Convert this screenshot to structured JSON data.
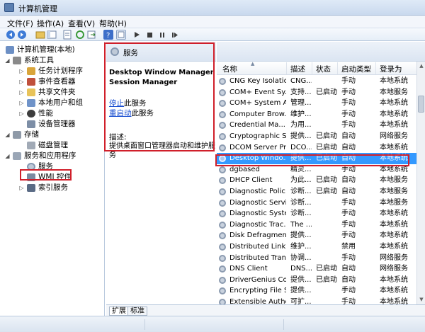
{
  "window": {
    "title": "计算机管理"
  },
  "menu": [
    {
      "label": "文件(F)"
    },
    {
      "label": "操作(A)"
    },
    {
      "label": "查看(V)"
    },
    {
      "label": "帮助(H)"
    }
  ],
  "toolbar": {
    "icons": [
      "back-icon",
      "forward-icon",
      "up-folder-icon",
      "console-tree-icon",
      "properties-icon",
      "refresh-icon",
      "export-icon",
      "help-icon",
      "view-icon",
      "play-icon",
      "stop-icon",
      "pause-icon",
      "restart-icon"
    ]
  },
  "tree": {
    "root": "计算机管理(本地)",
    "items": [
      {
        "label": "系统工具"
      },
      {
        "label": "任务计划程序"
      },
      {
        "label": "事件查看器"
      },
      {
        "label": "共享文件夹"
      },
      {
        "label": "本地用户和组"
      },
      {
        "label": "性能"
      },
      {
        "label": "设备管理器"
      },
      {
        "label": "存储"
      },
      {
        "label": "磁盘管理"
      },
      {
        "label": "服务和应用程序"
      },
      {
        "label": "服务"
      },
      {
        "label": "WMI 控件"
      },
      {
        "label": "索引服务"
      }
    ]
  },
  "description": {
    "header": "服务",
    "service_name": "Desktop Window Manager Session Manager",
    "stop_link": "停止",
    "stop_rest": "此服务",
    "restart_link": "重启动",
    "restart_rest": "此服务",
    "desc_label": "描述:",
    "desc_text": "提供桌面窗口管理器启动和维护服务"
  },
  "columns": {
    "name": "名称",
    "description": "描述",
    "status": "状态",
    "startup": "启动类型",
    "logon": "登录为"
  },
  "services": [
    {
      "name": "CNG Key Isolation",
      "description": "CNG...",
      "status": "",
      "startup": "手动",
      "logon": "本地系统"
    },
    {
      "name": "COM+ Event Sy...",
      "description": "支持...",
      "status": "已启动",
      "startup": "手动",
      "logon": "本地服务"
    },
    {
      "name": "COM+ System A...",
      "description": "管理...",
      "status": "",
      "startup": "手动",
      "logon": "本地系统"
    },
    {
      "name": "Computer Brow...",
      "description": "维护...",
      "status": "",
      "startup": "手动",
      "logon": "本地系统"
    },
    {
      "name": "Credential Ma...",
      "description": "为用...",
      "status": "",
      "startup": "手动",
      "logon": "本地系统"
    },
    {
      "name": "Cryptographic S...",
      "description": "提供...",
      "status": "已启动",
      "startup": "自动",
      "logon": "网络服务"
    },
    {
      "name": "DCOM Server Pr...",
      "description": "DCO...",
      "status": "已启动",
      "startup": "自动",
      "logon": "本地系统"
    },
    {
      "name": "Desktop Windo...",
      "description": "提供...",
      "status": "已启动",
      "startup": "自动",
      "logon": "本地系统"
    },
    {
      "name": "dgbased",
      "description": "精灵...",
      "status": "",
      "startup": "手动",
      "logon": "本地系统"
    },
    {
      "name": "DHCP Client",
      "description": "为此...",
      "status": "已启动",
      "startup": "自动",
      "logon": "本地服务"
    },
    {
      "name": "Diagnostic Polic...",
      "description": "诊断...",
      "status": "已启动",
      "startup": "自动",
      "logon": "本地服务"
    },
    {
      "name": "Diagnostic Servi...",
      "description": "诊断...",
      "status": "",
      "startup": "手动",
      "logon": "本地服务"
    },
    {
      "name": "Diagnostic Syste...",
      "description": "诊断...",
      "status": "",
      "startup": "手动",
      "logon": "本地系统"
    },
    {
      "name": "Diagnostic Trac...",
      "description": "The ...",
      "status": "",
      "startup": "手动",
      "logon": "本地系统"
    },
    {
      "name": "Disk Defragmen...",
      "description": "提供...",
      "status": "",
      "startup": "手动",
      "logon": "本地系统"
    },
    {
      "name": "Distributed Link ...",
      "description": "维护...",
      "status": "",
      "startup": "禁用",
      "logon": "本地系统"
    },
    {
      "name": "Distributed Tran...",
      "description": "协调...",
      "status": "",
      "startup": "手动",
      "logon": "网络服务"
    },
    {
      "name": "DNS Client",
      "description": "DNS...",
      "status": "已启动",
      "startup": "自动",
      "logon": "网络服务"
    },
    {
      "name": "DriverGenius Co...",
      "description": "提供...",
      "status": "已启动",
      "startup": "自动",
      "logon": "本地系统"
    },
    {
      "name": "Encrypting File S...",
      "description": "提供...",
      "status": "",
      "startup": "手动",
      "logon": "本地系统"
    },
    {
      "name": "Extensible Authe...",
      "description": "可扩...",
      "status": "",
      "startup": "手动",
      "logon": "本地系统"
    }
  ],
  "tabs": [
    {
      "label": "扩展"
    },
    {
      "label": "标准"
    }
  ],
  "colors": {
    "highlight": "#d01f2a",
    "selection": "#3399ff",
    "link": "#1a4fd1"
  }
}
